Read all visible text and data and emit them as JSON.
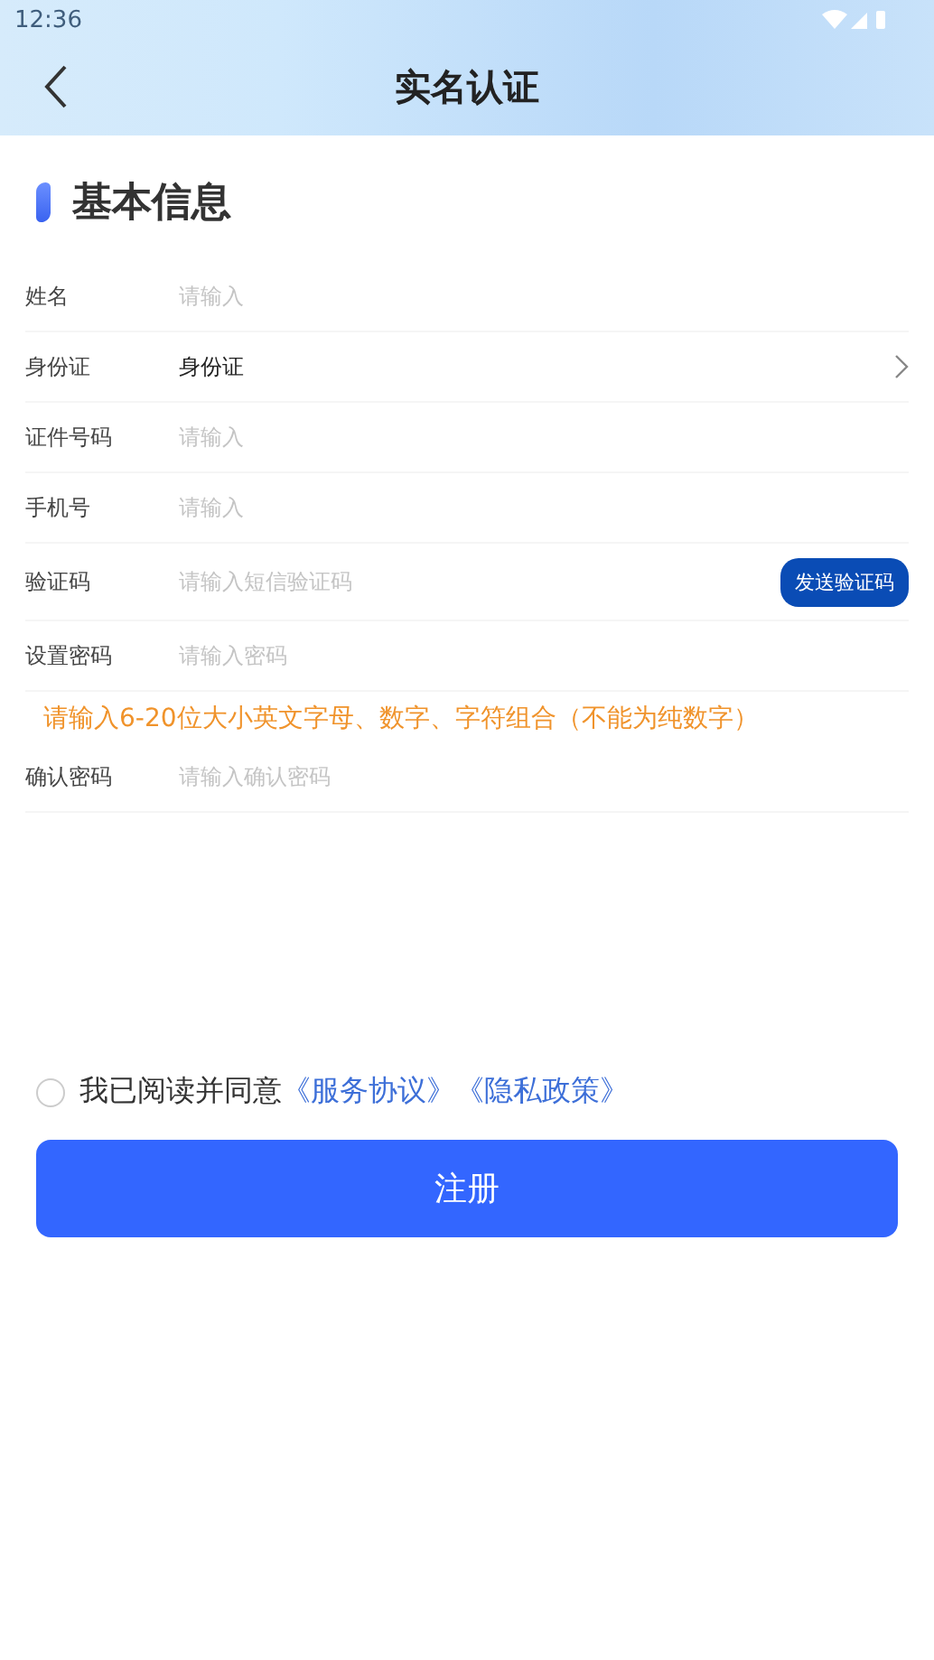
{
  "status_bar": {
    "time": "12:36"
  },
  "header": {
    "title": "实名认证"
  },
  "section": {
    "title": "基本信息"
  },
  "fields": [
    {
      "kind": "input",
      "label": "姓名",
      "placeholder": "请输入"
    },
    {
      "kind": "select",
      "label": "身份证",
      "value": "身份证"
    },
    {
      "kind": "input",
      "label": "证件号码",
      "placeholder": "请输入"
    },
    {
      "kind": "input",
      "label": "手机号",
      "placeholder": "请输入"
    },
    {
      "kind": "code",
      "label": "验证码",
      "placeholder": "请输入短信验证码",
      "button": "发送验证码"
    },
    {
      "kind": "input",
      "label": "设置密码",
      "placeholder": "请输入密码"
    },
    {
      "kind": "hint",
      "text": "请输入6-20位大小英文字母、数字、字符组合（不能为纯数字）"
    },
    {
      "kind": "input",
      "label": "确认密码",
      "placeholder": "请输入确认密码"
    }
  ],
  "agreement": {
    "checked": false,
    "text": "我已阅读并同意",
    "links": [
      "《服务协议》",
      "《隐私政策》"
    ]
  },
  "submit": "注册"
}
